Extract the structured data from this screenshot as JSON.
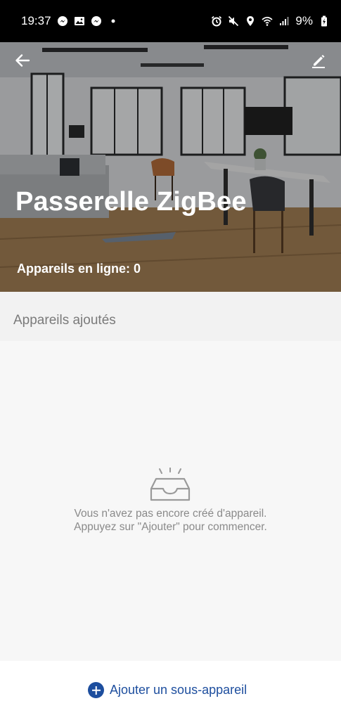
{
  "status_bar": {
    "time": "19:37",
    "battery": "9%",
    "left_icons": [
      "messenger-icon",
      "gallery-icon",
      "messenger-icon",
      "dot-icon"
    ],
    "right_icons": [
      "alarm-icon",
      "mute-icon",
      "location-icon",
      "wifi-icon",
      "signal-icon",
      "battery-icon"
    ]
  },
  "header": {
    "back_icon": "arrow-left-icon",
    "edit_icon": "pencil-icon",
    "title": "Passerelle ZigBee",
    "online_devices": "Appareils en ligne: 0"
  },
  "section": {
    "title": "Appareils ajoutés"
  },
  "empty_state": {
    "icon": "empty-inbox-icon",
    "line1": "Vous n'avez pas encore créé d'appareil.",
    "line2": "Appuyez sur \"Ajouter\" pour commencer."
  },
  "footer": {
    "add_label": "Ajouter un sous-appareil",
    "add_icon": "plus-circle-icon"
  },
  "colors": {
    "accent": "#1d4e9e",
    "status_bar": "#000000",
    "section_bg": "#f2f2f2",
    "content_bg": "#f7f7f7",
    "muted_text": "#8a8a8a"
  }
}
